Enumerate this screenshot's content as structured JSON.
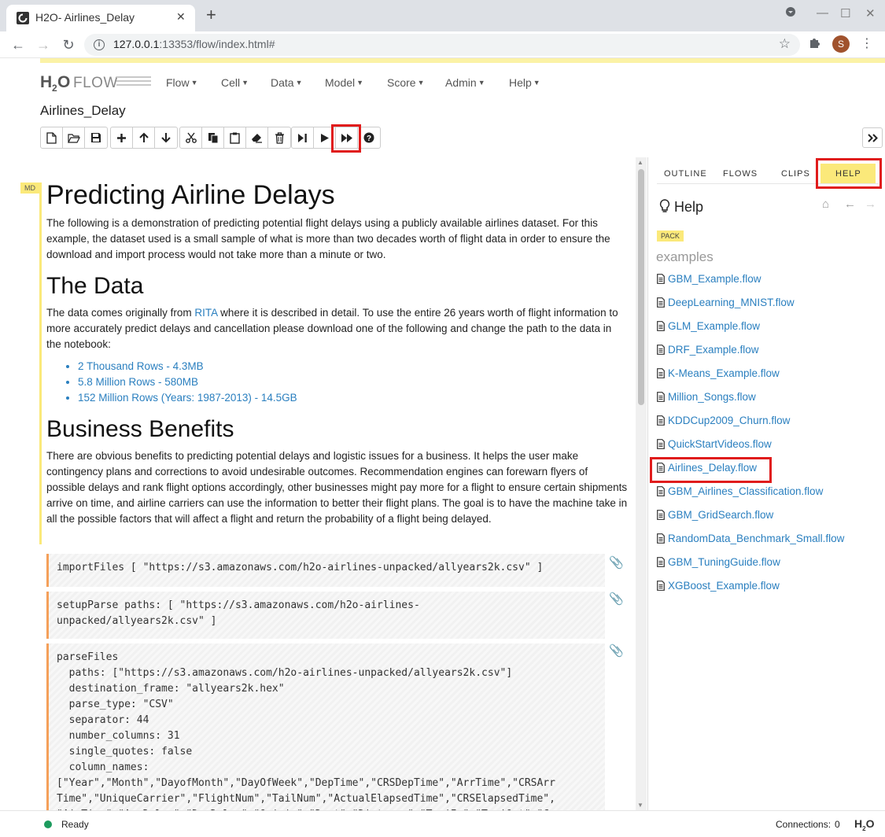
{
  "browser": {
    "tab_title": "H2O- Airlines_Delay",
    "url_host": "127.0.0.1",
    "url_rest": ":13353/flow/index.html#",
    "profile_initial": "S"
  },
  "app": {
    "logo_h": "H",
    "logo_2": "2",
    "logo_o": "O",
    "logo_flow": "FLOW",
    "menus": [
      "Flow",
      "Cell",
      "Data",
      "Model",
      "Score",
      "Admin",
      "Help"
    ],
    "notebook_title": "Airlines_Delay"
  },
  "notebook": {
    "cell_type_badge": "MD",
    "h1": "Predicting Airline Delays",
    "intro": "The following is a demonstration of predicting potential flight delays using a publicly available airlines dataset. For this example, the dataset used is a small sample of what is more than two decades worth of flight data in order to ensure the download and import process would not take more than a minute or two.",
    "data_heading": "The Data",
    "data_p_before": "The data comes originally from ",
    "data_p_link": "RITA",
    "data_p_after": " where it is described in detail. To use the entire 26 years worth of flight information to more accurately predict delays and cancellation please download one of the following and change the path to the data in the notebook:",
    "data_links": [
      "2 Thousand Rows - 4.3MB",
      "5.8 Million Rows - 580MB",
      "152 Million Rows (Years: 1987-2013) - 14.5GB"
    ],
    "benefits_heading": "Business Benefits",
    "benefits_p": "There are obvious benefits to predicting potential delays and logistic issues for a business. It helps the user make contingency plans and corrections to avoid undesirable outcomes. Recommendation engines can forewarn flyers of possible delays and rank flight options accordingly, other businesses might pay more for a flight to ensure certain shipments arrive on time, and airline carriers can use the information to better their flight plans. The goal is to have the machine take in all the possible factors that will affect a flight and return the probability of a flight being delayed.",
    "code_cells": [
      "importFiles [ \"https://s3.amazonaws.com/h2o-airlines-unpacked/allyears2k.csv\" ]",
      "setupParse paths: [ \"https://s3.amazonaws.com/h2o-airlines-\nunpacked/allyears2k.csv\" ]",
      "parseFiles\n  paths: [\"https://s3.amazonaws.com/h2o-airlines-unpacked/allyears2k.csv\"]\n  destination_frame: \"allyears2k.hex\"\n  parse_type: \"CSV\"\n  separator: 44\n  number_columns: 31\n  single_quotes: false\n  column_names:\n[\"Year\",\"Month\",\"DayofMonth\",\"DayOfWeek\",\"DepTime\",\"CRSDepTime\",\"ArrTime\",\"CRSArr\nTime\",\"UniqueCarrier\",\"FlightNum\",\"TailNum\",\"ActualElapsedTime\",\"CRSElapsedTime\",\n\"AirTime\",\"ArrDelay\",\"DepDelay\",\"Origin\",\"Dest\",\"Distance\",\"TaxiIn\",\"TaxiOut\",\"Ca"
    ]
  },
  "sidebar": {
    "tabs": [
      "OUTLINE",
      "FLOWS",
      "CLIPS",
      "HELP"
    ],
    "help_title": "Help",
    "pack_badge": "PACK",
    "examples_title": "examples",
    "examples": [
      "GBM_Example.flow",
      "DeepLearning_MNIST.flow",
      "GLM_Example.flow",
      "DRF_Example.flow",
      "K-Means_Example.flow",
      "Million_Songs.flow",
      "KDDCup2009_Churn.flow",
      "QuickStartVideos.flow",
      "Airlines_Delay.flow",
      "GBM_Airlines_Classification.flow",
      "GBM_GridSearch.flow",
      "RandomData_Benchmark_Small.flow",
      "GBM_TuningGuide.flow",
      "XGBoost_Example.flow"
    ]
  },
  "status": {
    "state": "Ready",
    "connections_label": "Connections:",
    "connections_count": "0",
    "mini_logo_h": "H",
    "mini_logo_2": "2",
    "mini_logo_o": "O"
  },
  "colors": {
    "link": "#2a7fbf",
    "highlight_box": "#e01c1c",
    "md_accent": "#fbe97a",
    "code_accent": "#f5a05a",
    "status_ok": "#1d9b5e"
  }
}
